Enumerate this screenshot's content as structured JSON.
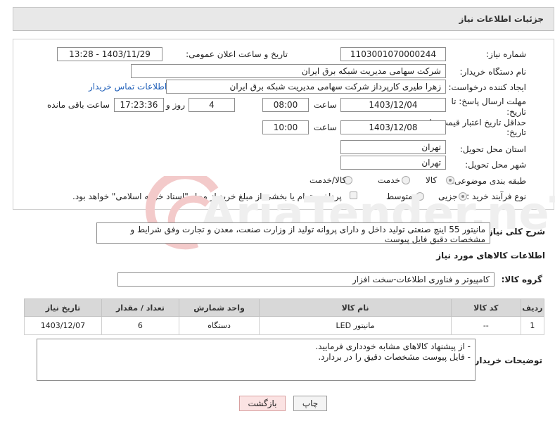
{
  "header": {
    "title": "جزئیات اطلاعات نیاز"
  },
  "form": {
    "need_number": {
      "label": "شماره نیاز:",
      "value": "1103001070000244"
    },
    "announce": {
      "label": "تاریخ و ساعت اعلان عمومی:",
      "value": "1403/11/29 - 13:28"
    },
    "buyer": {
      "label": "نام دستگاه خریدار:",
      "value": "شرکت سهامی مدیریت شبکه برق ایران"
    },
    "creator": {
      "label": "ایجاد کننده درخواست:",
      "value": "زهرا طیری کارپرداز شرکت سهامی مدیریت شبکه برق ایران",
      "contact_link": "اطلاعات تماس خریدار"
    },
    "reply_deadline": {
      "label": "مهلت ارسال پاسخ: تا",
      "label2": "تاریخ:",
      "date": "1403/12/04",
      "time_label": "ساعت",
      "time": "08:00",
      "days": "4",
      "days_label": "روز و",
      "remaining": "17:23:36",
      "remaining_label": "ساعت باقی مانده"
    },
    "price_validity": {
      "label": "حداقل تاریخ اعتبار قیمت: تا",
      "label2": "تاریخ:",
      "date": "1403/12/08",
      "time_label": "ساعت",
      "time": "10:00"
    },
    "province": {
      "label": "استان محل تحویل:",
      "value": "تهران"
    },
    "city": {
      "label": "شهر محل تحویل:",
      "value": "تهران"
    },
    "category": {
      "label": "طبقه بندی موضوعی:",
      "options": [
        "کالا",
        "خدمت",
        "کالا/خدمت"
      ],
      "selected": 0
    },
    "process": {
      "label": "نوع فرآیند خرید :",
      "options": [
        "جزیی",
        "متوسط"
      ],
      "selected": 0,
      "payment_text": "پرداخت تمام یا بخشی از مبلغ خرید،از محل \"اسناد خزانه اسلامی\" خواهد بود."
    }
  },
  "description": {
    "label": "شرح کلی نیاز:",
    "value": "مانیتور 55 اینچ صنعتی تولید داخل و دارای پروانه تولید از وزارت صنعت، معدن و تجارت وفق شرایط و مشخصات دقیق فایل پیوست"
  },
  "goods_section": {
    "title": "اطلاعات کالاهای مورد نیاز",
    "group_label": "گروه کالا:",
    "group_value": "کامپیوتر و فناوری اطلاعات-سخت افزار"
  },
  "table": {
    "headers": [
      "ردیف",
      "کد کالا",
      "نام کالا",
      "واحد شمارش",
      "تعداد / مقدار",
      "تاریخ نیاز"
    ],
    "rows": [
      [
        "1",
        "--",
        "مانیتور LED",
        "دستگاه",
        "6",
        "1403/12/07"
      ]
    ]
  },
  "buyer_notes": {
    "label": "توضیحات خریدار:",
    "line1": "- از پیشنهاد کالاهای مشابه خودداری فرمایید.",
    "line2": "- فایل پیوست مشخصات دقیق را در بردارد."
  },
  "buttons": {
    "print": "چاپ",
    "back": "بازگشت"
  },
  "watermark": {
    "text": "AriaTender.neT"
  }
}
